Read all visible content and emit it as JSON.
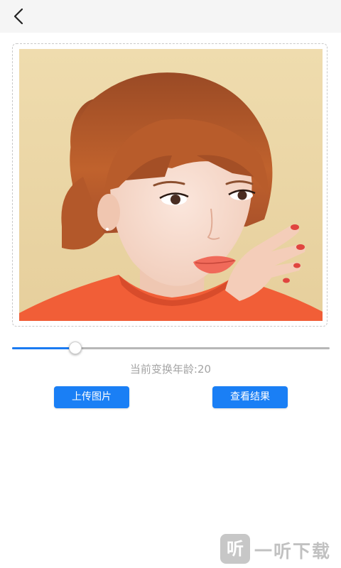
{
  "header": {
    "back_icon": "chevron-left-icon"
  },
  "photo": {
    "description_icon": "portrait-photo",
    "background_color": "#ead6a8",
    "hair_color": "#b4592a",
    "sweater_color": "#f0603a"
  },
  "age_slider": {
    "value_fraction": 0.2,
    "fill_color": "#1b7bf2",
    "track_color": "#b7b7b7"
  },
  "age_label": "当前变换年龄:20",
  "buttons": {
    "upload_label": "上传图片",
    "result_label": "查看结果",
    "color": "#1a7ff5"
  },
  "watermark": {
    "logo_text": "听",
    "text": "一听下载"
  }
}
